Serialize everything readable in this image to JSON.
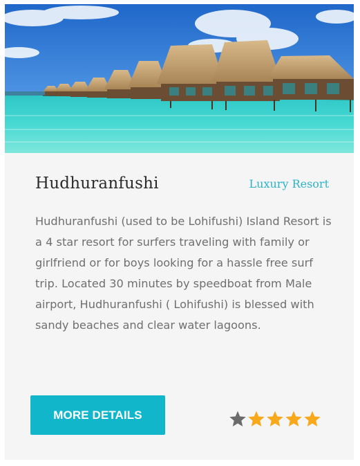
{
  "card": {
    "title": "Hudhuranfushi",
    "category": "Luxury Resort",
    "description": "Hudhuranfushi (used to be Lohifushi) Island Resort is a 4 star resort for surfers traveling with family or girlfriend or for boys looking for a hassle free surf trip. Located 30 minutes by speedboat from Male airport, Hudhuranfushi ( Lohifushi) is blessed with sandy beaches and clear water lagoons.",
    "button_label": "MORE DETAILS",
    "rating": {
      "stars": [
        {
          "icon": "star-icon",
          "color": "#6b6b6b"
        },
        {
          "icon": "star-icon",
          "color": "#f7a81b"
        },
        {
          "icon": "star-icon",
          "color": "#f7a81b"
        },
        {
          "icon": "star-icon",
          "color": "#f7a81b"
        },
        {
          "icon": "star-icon",
          "color": "#f7a81b"
        }
      ]
    }
  },
  "colors": {
    "accent": "#11b6cb",
    "category_text": "#2bb3c9",
    "star_active": "#f7a81b",
    "star_inactive": "#6b6b6b"
  }
}
